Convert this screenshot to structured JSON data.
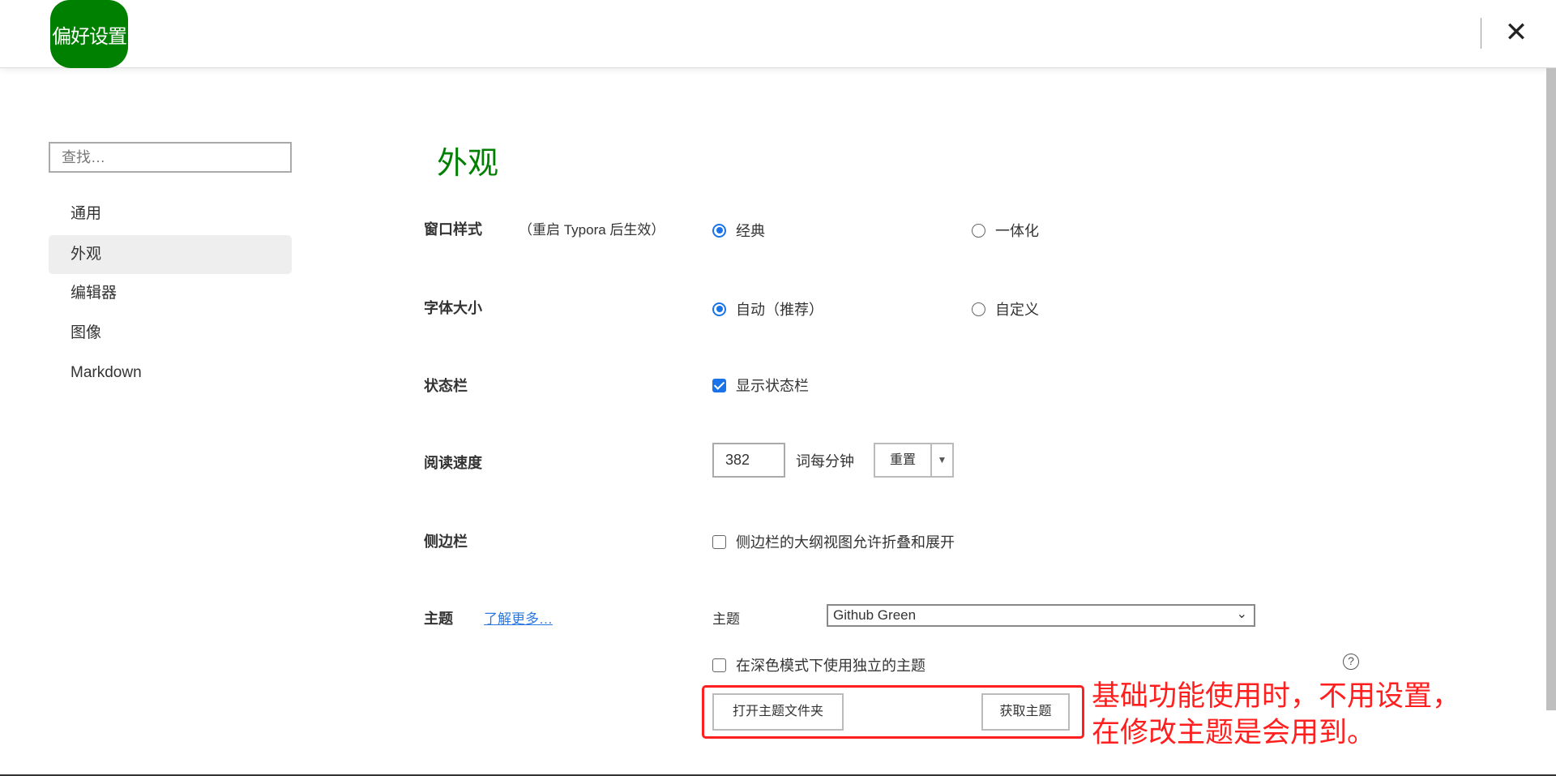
{
  "header": {
    "title": "偏好设置",
    "close_icon": "close-icon"
  },
  "sidebar": {
    "search_placeholder": "查找…",
    "items": [
      {
        "label": "通用"
      },
      {
        "label": "外观",
        "active": true
      },
      {
        "label": "编辑器"
      },
      {
        "label": "图像"
      },
      {
        "label": "Markdown"
      }
    ]
  },
  "main": {
    "title": "外观",
    "window_style": {
      "label": "窗口样式",
      "note": "（重启 Typora 后生效）",
      "options": [
        {
          "label": "经典",
          "selected": true
        },
        {
          "label": "一体化",
          "selected": false
        }
      ]
    },
    "font_size": {
      "label": "字体大小",
      "options": [
        {
          "label": "自动（推荐）",
          "selected": true
        },
        {
          "label": "自定义",
          "selected": false
        }
      ]
    },
    "status_bar": {
      "label": "状态栏",
      "checkbox": "显示状态栏",
      "checked": true
    },
    "reading_speed": {
      "label": "阅读速度",
      "value": "382",
      "unit": "词每分钟",
      "reset": "重置"
    },
    "sidebar_opt": {
      "label": "侧边栏",
      "checkbox": "侧边栏的大纲视图允许折叠和展开",
      "checked": false
    },
    "theme": {
      "label": "主题",
      "learn_more": "了解更多…",
      "select_label": "主题",
      "selected": "Github Green",
      "dark_checkbox": "在深色模式下使用独立的主题",
      "dark_checked": false,
      "help": "?",
      "open_folder": "打开主题文件夹",
      "get_themes": "获取主题"
    }
  },
  "annotation": {
    "line1": "基础功能使用时，不用设置，",
    "line2": "在修改主题是会用到。",
    "color": "#ff1f1f"
  },
  "colors": {
    "accent": "#008000",
    "checkbox": "#1a73e8"
  }
}
